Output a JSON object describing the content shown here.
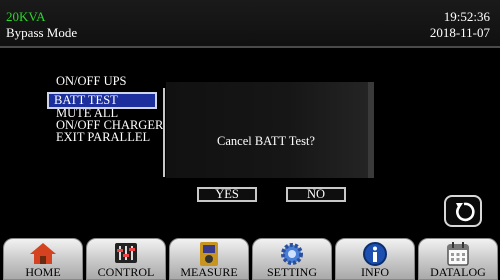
{
  "header": {
    "model": "20KVA",
    "mode": "Bypass Mode",
    "time": "19:52:36",
    "date": "2018-11-07"
  },
  "menu": {
    "items": [
      {
        "label": "ON/OFF UPS"
      },
      {
        "label": "BATT TEST",
        "selected": true
      },
      {
        "label": "MUTE ALL"
      },
      {
        "label": "ON/OFF CHARGER"
      },
      {
        "label": "EXIT PARALLEL"
      }
    ]
  },
  "dialog": {
    "message": "Cancel BATT Test?",
    "yes_label": "YES",
    "no_label": "NO"
  },
  "tabs": [
    {
      "label": "HOME",
      "icon": "home-icon"
    },
    {
      "label": "CONTROL",
      "icon": "sliders-icon",
      "active": true
    },
    {
      "label": "MEASURE",
      "icon": "meter-icon"
    },
    {
      "label": "SETTING",
      "icon": "gear-icon"
    },
    {
      "label": "INFO",
      "icon": "info-icon"
    },
    {
      "label": "DATALOG",
      "icon": "calendar-icon"
    }
  ],
  "colors": {
    "model_text": "#2bd62b",
    "selection_bg": "#1c2f9c"
  },
  "back_button": {
    "icon": "refresh-back-icon"
  }
}
